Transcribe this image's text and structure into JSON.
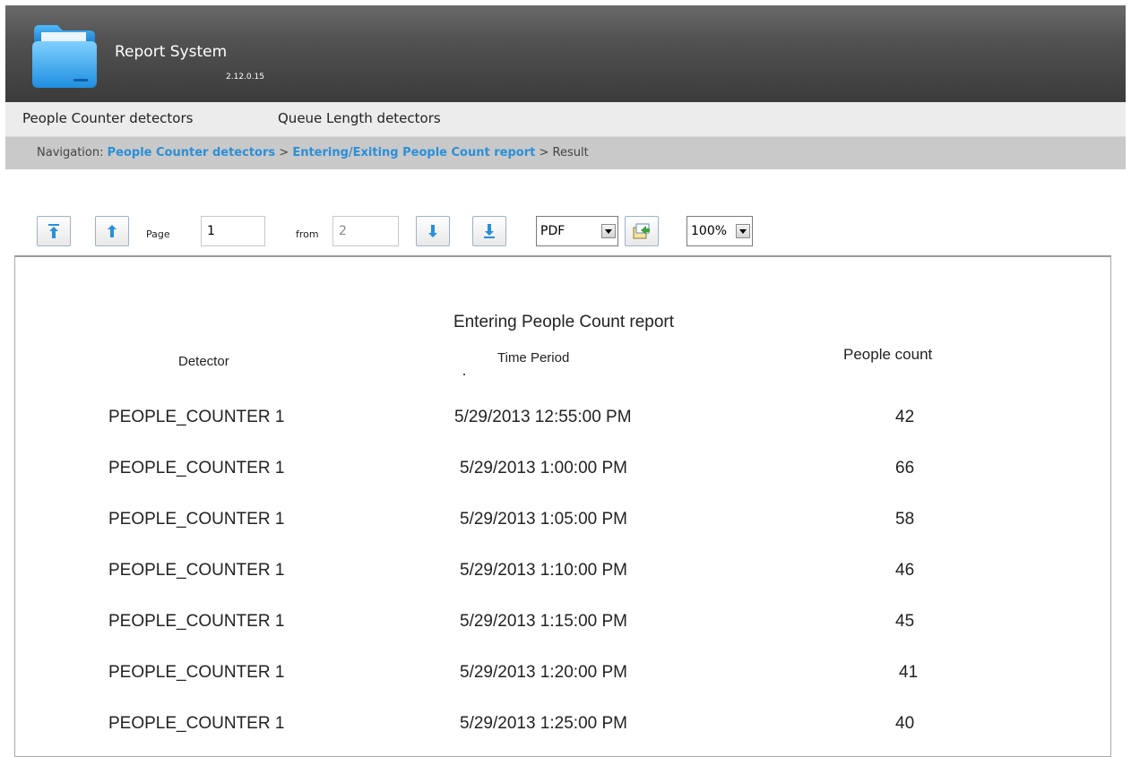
{
  "app": {
    "title": "Report System",
    "version": "2.12.0.15"
  },
  "menu": {
    "items": [
      "People Counter detectors",
      "Queue Length detectors"
    ]
  },
  "breadcrumb": {
    "prefix": "Navigation:",
    "link1": "People Counter detectors",
    "sep": ">",
    "link2": "Entering/Exiting People Count report",
    "current": "Result"
  },
  "toolbar": {
    "page_label": "Page",
    "page_value": "1",
    "from_label": "from",
    "total_pages": "2",
    "export_format": "PDF",
    "zoom": "100%"
  },
  "report": {
    "title": "Entering People Count report",
    "columns": [
      "Detector",
      "Time Period",
      "People count"
    ],
    "rows": [
      [
        "PEOPLE_COUNTER 1",
        "5/29/2013 12:55:00 PM",
        "42"
      ],
      [
        "PEOPLE_COUNTER 1",
        "5/29/2013 1:00:00 PM",
        "66"
      ],
      [
        "PEOPLE_COUNTER 1",
        "5/29/2013 1:05:00 PM",
        "58"
      ],
      [
        "PEOPLE_COUNTER 1",
        "5/29/2013 1:10:00 PM",
        "46"
      ],
      [
        "PEOPLE_COUNTER 1",
        "5/29/2013 1:15:00 PM",
        "45"
      ],
      [
        "PEOPLE_COUNTER 1",
        "5/29/2013 1:20:00 PM",
        "41"
      ],
      [
        "PEOPLE_COUNTER 1",
        "5/29/2013 1:25:00 PM",
        "40"
      ]
    ]
  }
}
